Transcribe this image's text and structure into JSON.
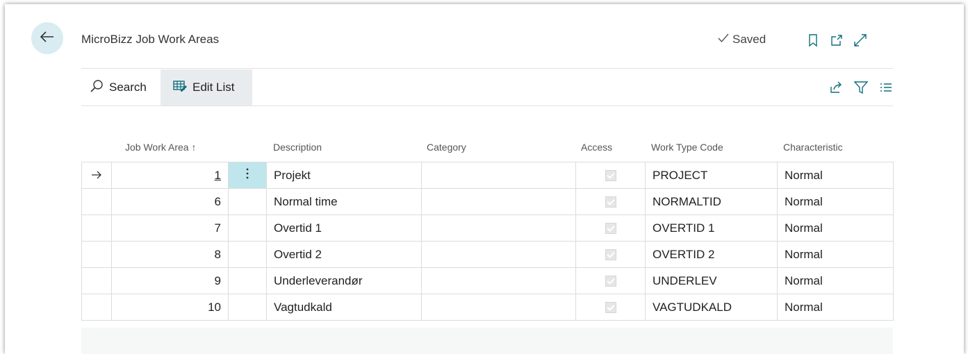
{
  "page": {
    "title": "MicroBizz Job Work Areas",
    "status": "Saved"
  },
  "actions": {
    "search_label": "Search",
    "edit_list_label": "Edit List"
  },
  "columns": {
    "job_work_area": "Job Work Area",
    "sort_indicator": "↑",
    "description": "Description",
    "category": "Category",
    "access": "Access",
    "work_type_code": "Work Type Code",
    "characteristic": "Characteristic"
  },
  "rows": [
    {
      "job_work_area": "1",
      "description": "Projekt",
      "category": "",
      "access": true,
      "work_type_code": "PROJECT",
      "characteristic": "Normal"
    },
    {
      "job_work_area": "6",
      "description": "Normal time",
      "category": "",
      "access": true,
      "work_type_code": "NORMALTID",
      "characteristic": "Normal"
    },
    {
      "job_work_area": "7",
      "description": "Overtid 1",
      "category": "",
      "access": true,
      "work_type_code": "OVERTID 1",
      "characteristic": "Normal"
    },
    {
      "job_work_area": "8",
      "description": "Overtid 2",
      "category": "",
      "access": true,
      "work_type_code": "OVERTID 2",
      "characteristic": "Normal"
    },
    {
      "job_work_area": "9",
      "description": "Underleverandør",
      "category": "",
      "access": true,
      "work_type_code": "UNDERLEV",
      "characteristic": "Normal"
    },
    {
      "job_work_area": "10",
      "description": "Vagtudkald",
      "category": "",
      "access": true,
      "work_type_code": "VAGTUDKALD",
      "characteristic": "Normal"
    }
  ],
  "icons": {
    "back": "arrow-left-icon",
    "saved": "check-icon",
    "bookmark": "bookmark-icon",
    "open_new": "open-in-new-window-icon",
    "expand": "expand-icon",
    "search": "search-icon",
    "edit_list": "edit-list-icon",
    "share": "share-icon",
    "filter": "filter-icon",
    "list": "list-options-icon",
    "row_arrow": "current-row-arrow-icon",
    "row_menu": "more-vertical-icon"
  },
  "colors": {
    "accent": "#bfe6ec",
    "back_button_bg": "#d8ecf1",
    "icon_teal": "#0f6f7c"
  }
}
